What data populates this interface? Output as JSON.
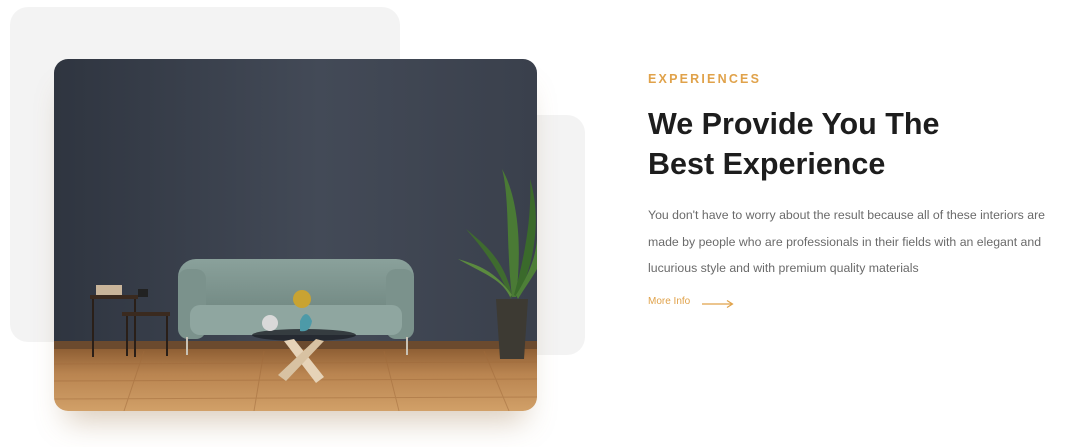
{
  "section": {
    "eyebrow": "EXPERIENCES",
    "heading_line1": "We Provide You The",
    "heading_line2": "Best Experience",
    "description": "You don't have to worry about the result because all of these interiors are made by people who are professionals in their fields with an elegant and lucurious style and with premium quality materials",
    "more_label": "More Info",
    "more_icon": "arrow-right-icon"
  },
  "colors": {
    "accent": "#e0a24a",
    "heading": "#1d1d1d",
    "body_text": "#6a6a6a",
    "panel": "#f3f3f3",
    "wall": "#3c4350",
    "floor": "#b07a45",
    "sofa": "#7e958f"
  }
}
